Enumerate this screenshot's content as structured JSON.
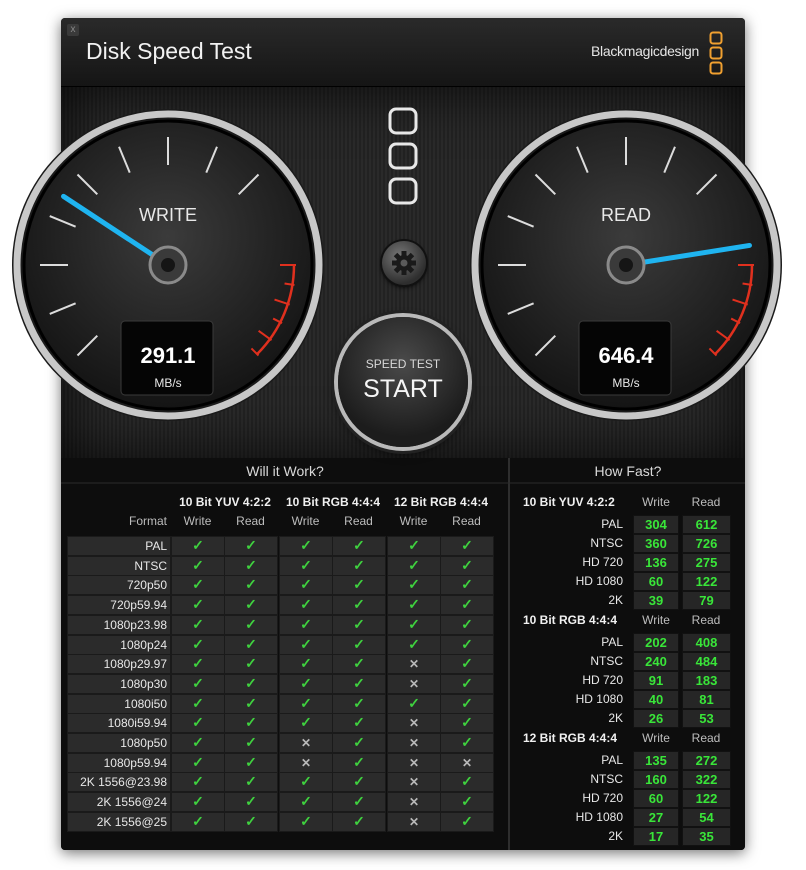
{
  "window": {
    "title": "Disk Speed Test",
    "close_glyph": "x",
    "brand": "Blackmagicdesign"
  },
  "gauges": {
    "write": {
      "label": "WRITE",
      "value": "291.1",
      "unit": "MB/s",
      "needle_fraction": 0.29
    },
    "read": {
      "label": "READ",
      "value": "646.4",
      "unit": "MB/s",
      "needle_fraction": 0.8
    }
  },
  "controls": {
    "settings_icon": "gear-icon",
    "start_top": "SPEED TEST",
    "start_main": "START"
  },
  "will_it_work": {
    "title": "Will it Work?",
    "format_header": "Format",
    "groups": [
      "10 Bit YUV 4:2:2",
      "10 Bit RGB 4:4:4",
      "12 Bit RGB 4:4:4"
    ],
    "sub_headers": [
      "Write",
      "Read",
      "Write",
      "Read",
      "Write",
      "Read"
    ],
    "ok_glyph": "✓",
    "no_glyph": "✕",
    "rows": [
      {
        "format": "PAL",
        "marks": [
          1,
          1,
          1,
          1,
          1,
          1
        ]
      },
      {
        "format": "NTSC",
        "marks": [
          1,
          1,
          1,
          1,
          1,
          1
        ]
      },
      {
        "format": "720p50",
        "marks": [
          1,
          1,
          1,
          1,
          1,
          1
        ]
      },
      {
        "format": "720p59.94",
        "marks": [
          1,
          1,
          1,
          1,
          1,
          1
        ]
      },
      {
        "format": "1080p23.98",
        "marks": [
          1,
          1,
          1,
          1,
          1,
          1
        ]
      },
      {
        "format": "1080p24",
        "marks": [
          1,
          1,
          1,
          1,
          1,
          1
        ]
      },
      {
        "format": "1080p29.97",
        "marks": [
          1,
          1,
          1,
          1,
          0,
          1
        ]
      },
      {
        "format": "1080p30",
        "marks": [
          1,
          1,
          1,
          1,
          0,
          1
        ]
      },
      {
        "format": "1080i50",
        "marks": [
          1,
          1,
          1,
          1,
          1,
          1
        ]
      },
      {
        "format": "1080i59.94",
        "marks": [
          1,
          1,
          1,
          1,
          0,
          1
        ]
      },
      {
        "format": "1080p50",
        "marks": [
          1,
          1,
          0,
          1,
          0,
          1
        ]
      },
      {
        "format": "1080p59.94",
        "marks": [
          1,
          1,
          0,
          1,
          0,
          0
        ]
      },
      {
        "format": "2K 1556@23.98",
        "marks": [
          1,
          1,
          1,
          1,
          0,
          1
        ]
      },
      {
        "format": "2K 1556@24",
        "marks": [
          1,
          1,
          1,
          1,
          0,
          1
        ]
      },
      {
        "format": "2K 1556@25",
        "marks": [
          1,
          1,
          1,
          1,
          0,
          1
        ]
      }
    ]
  },
  "how_fast": {
    "title": "How Fast?",
    "write_header": "Write",
    "read_header": "Read",
    "sections": [
      {
        "name": "10 Bit YUV 4:2:2",
        "rows": [
          {
            "label": "PAL",
            "write": "304",
            "read": "612"
          },
          {
            "label": "NTSC",
            "write": "360",
            "read": "726"
          },
          {
            "label": "HD 720",
            "write": "136",
            "read": "275"
          },
          {
            "label": "HD 1080",
            "write": "60",
            "read": "122"
          },
          {
            "label": "2K",
            "write": "39",
            "read": "79"
          }
        ]
      },
      {
        "name": "10 Bit RGB 4:4:4",
        "rows": [
          {
            "label": "PAL",
            "write": "202",
            "read": "408"
          },
          {
            "label": "NTSC",
            "write": "240",
            "read": "484"
          },
          {
            "label": "HD 720",
            "write": "91",
            "read": "183"
          },
          {
            "label": "HD 1080",
            "write": "40",
            "read": "81"
          },
          {
            "label": "2K",
            "write": "26",
            "read": "53"
          }
        ]
      },
      {
        "name": "12 Bit RGB 4:4:4",
        "rows": [
          {
            "label": "PAL",
            "write": "135",
            "read": "272"
          },
          {
            "label": "NTSC",
            "write": "160",
            "read": "322"
          },
          {
            "label": "HD 720",
            "write": "60",
            "read": "122"
          },
          {
            "label": "HD 1080",
            "write": "27",
            "read": "54"
          },
          {
            "label": "2K",
            "write": "17",
            "read": "35"
          }
        ]
      }
    ]
  },
  "colors": {
    "needle": "#1fb4f0",
    "ok": "#3fd13f",
    "number": "#39e639",
    "danger": "#e0301e",
    "logo": "#f0a030"
  }
}
